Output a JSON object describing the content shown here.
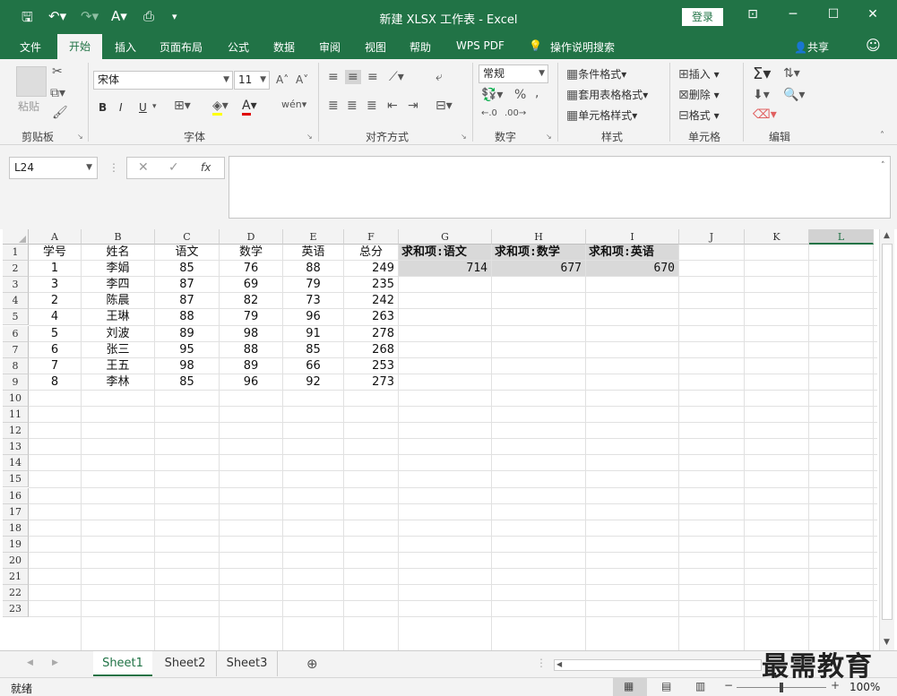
{
  "window": {
    "title": "新建 XLSX 工作表  -  Excel",
    "login": "登录"
  },
  "menu": {
    "items": [
      "文件",
      "开始",
      "插入",
      "页面布局",
      "公式",
      "数据",
      "审阅",
      "视图",
      "帮助",
      "WPS PDF",
      "操作说明搜索"
    ],
    "share": "共享"
  },
  "ribbon": {
    "clipboard": {
      "paste": "粘贴",
      "label": "剪贴板"
    },
    "font": {
      "name": "宋体",
      "size": "11",
      "label": "字体",
      "bold": "B",
      "italic": "I",
      "underline": "U"
    },
    "align": {
      "label": "对齐方式"
    },
    "number": {
      "format": "常规",
      "label": "数字"
    },
    "styles": {
      "cond": "条件格式",
      "table": "套用表格格式",
      "cell": "单元格样式",
      "label": "样式"
    },
    "cells": {
      "insert": "插入",
      "delete": "删除",
      "format": "格式",
      "label": "单元格"
    },
    "edit": {
      "label": "编辑"
    }
  },
  "formula_bar": {
    "name_box": "L24",
    "fx": "fx",
    "value": ""
  },
  "grid": {
    "columns": [
      "A",
      "B",
      "C",
      "D",
      "E",
      "F",
      "G",
      "H",
      "I",
      "J",
      "K",
      "L"
    ],
    "rows": [
      "1",
      "2",
      "3",
      "4",
      "5",
      "6",
      "7",
      "8",
      "9",
      "10",
      "11",
      "12",
      "13",
      "14",
      "15",
      "16",
      "17",
      "18",
      "19",
      "20",
      "21",
      "22",
      "23"
    ],
    "header": [
      "学号",
      "姓名",
      "语文",
      "数学",
      "英语",
      "总分"
    ],
    "data": [
      [
        "1",
        "李娟",
        "85",
        "76",
        "88",
        "249"
      ],
      [
        "3",
        "李四",
        "87",
        "69",
        "79",
        "235"
      ],
      [
        "2",
        "陈晨",
        "87",
        "82",
        "73",
        "242"
      ],
      [
        "4",
        "王琳",
        "88",
        "79",
        "96",
        "263"
      ],
      [
        "5",
        "刘波",
        "89",
        "98",
        "91",
        "278"
      ],
      [
        "6",
        "张三",
        "95",
        "88",
        "85",
        "268"
      ],
      [
        "7",
        "王五",
        "98",
        "89",
        "66",
        "253"
      ],
      [
        "8",
        "李林",
        "85",
        "96",
        "92",
        "273"
      ]
    ],
    "pivot_headers": [
      "求和项:语文",
      "求和项:数学",
      "求和项:英语"
    ],
    "pivot_values": [
      "714",
      "677",
      "670"
    ]
  },
  "sheets": [
    "Sheet1",
    "Sheet2",
    "Sheet3"
  ],
  "status": {
    "ready": "就绪",
    "zoom": "100%"
  },
  "watermark": "最需教育"
}
